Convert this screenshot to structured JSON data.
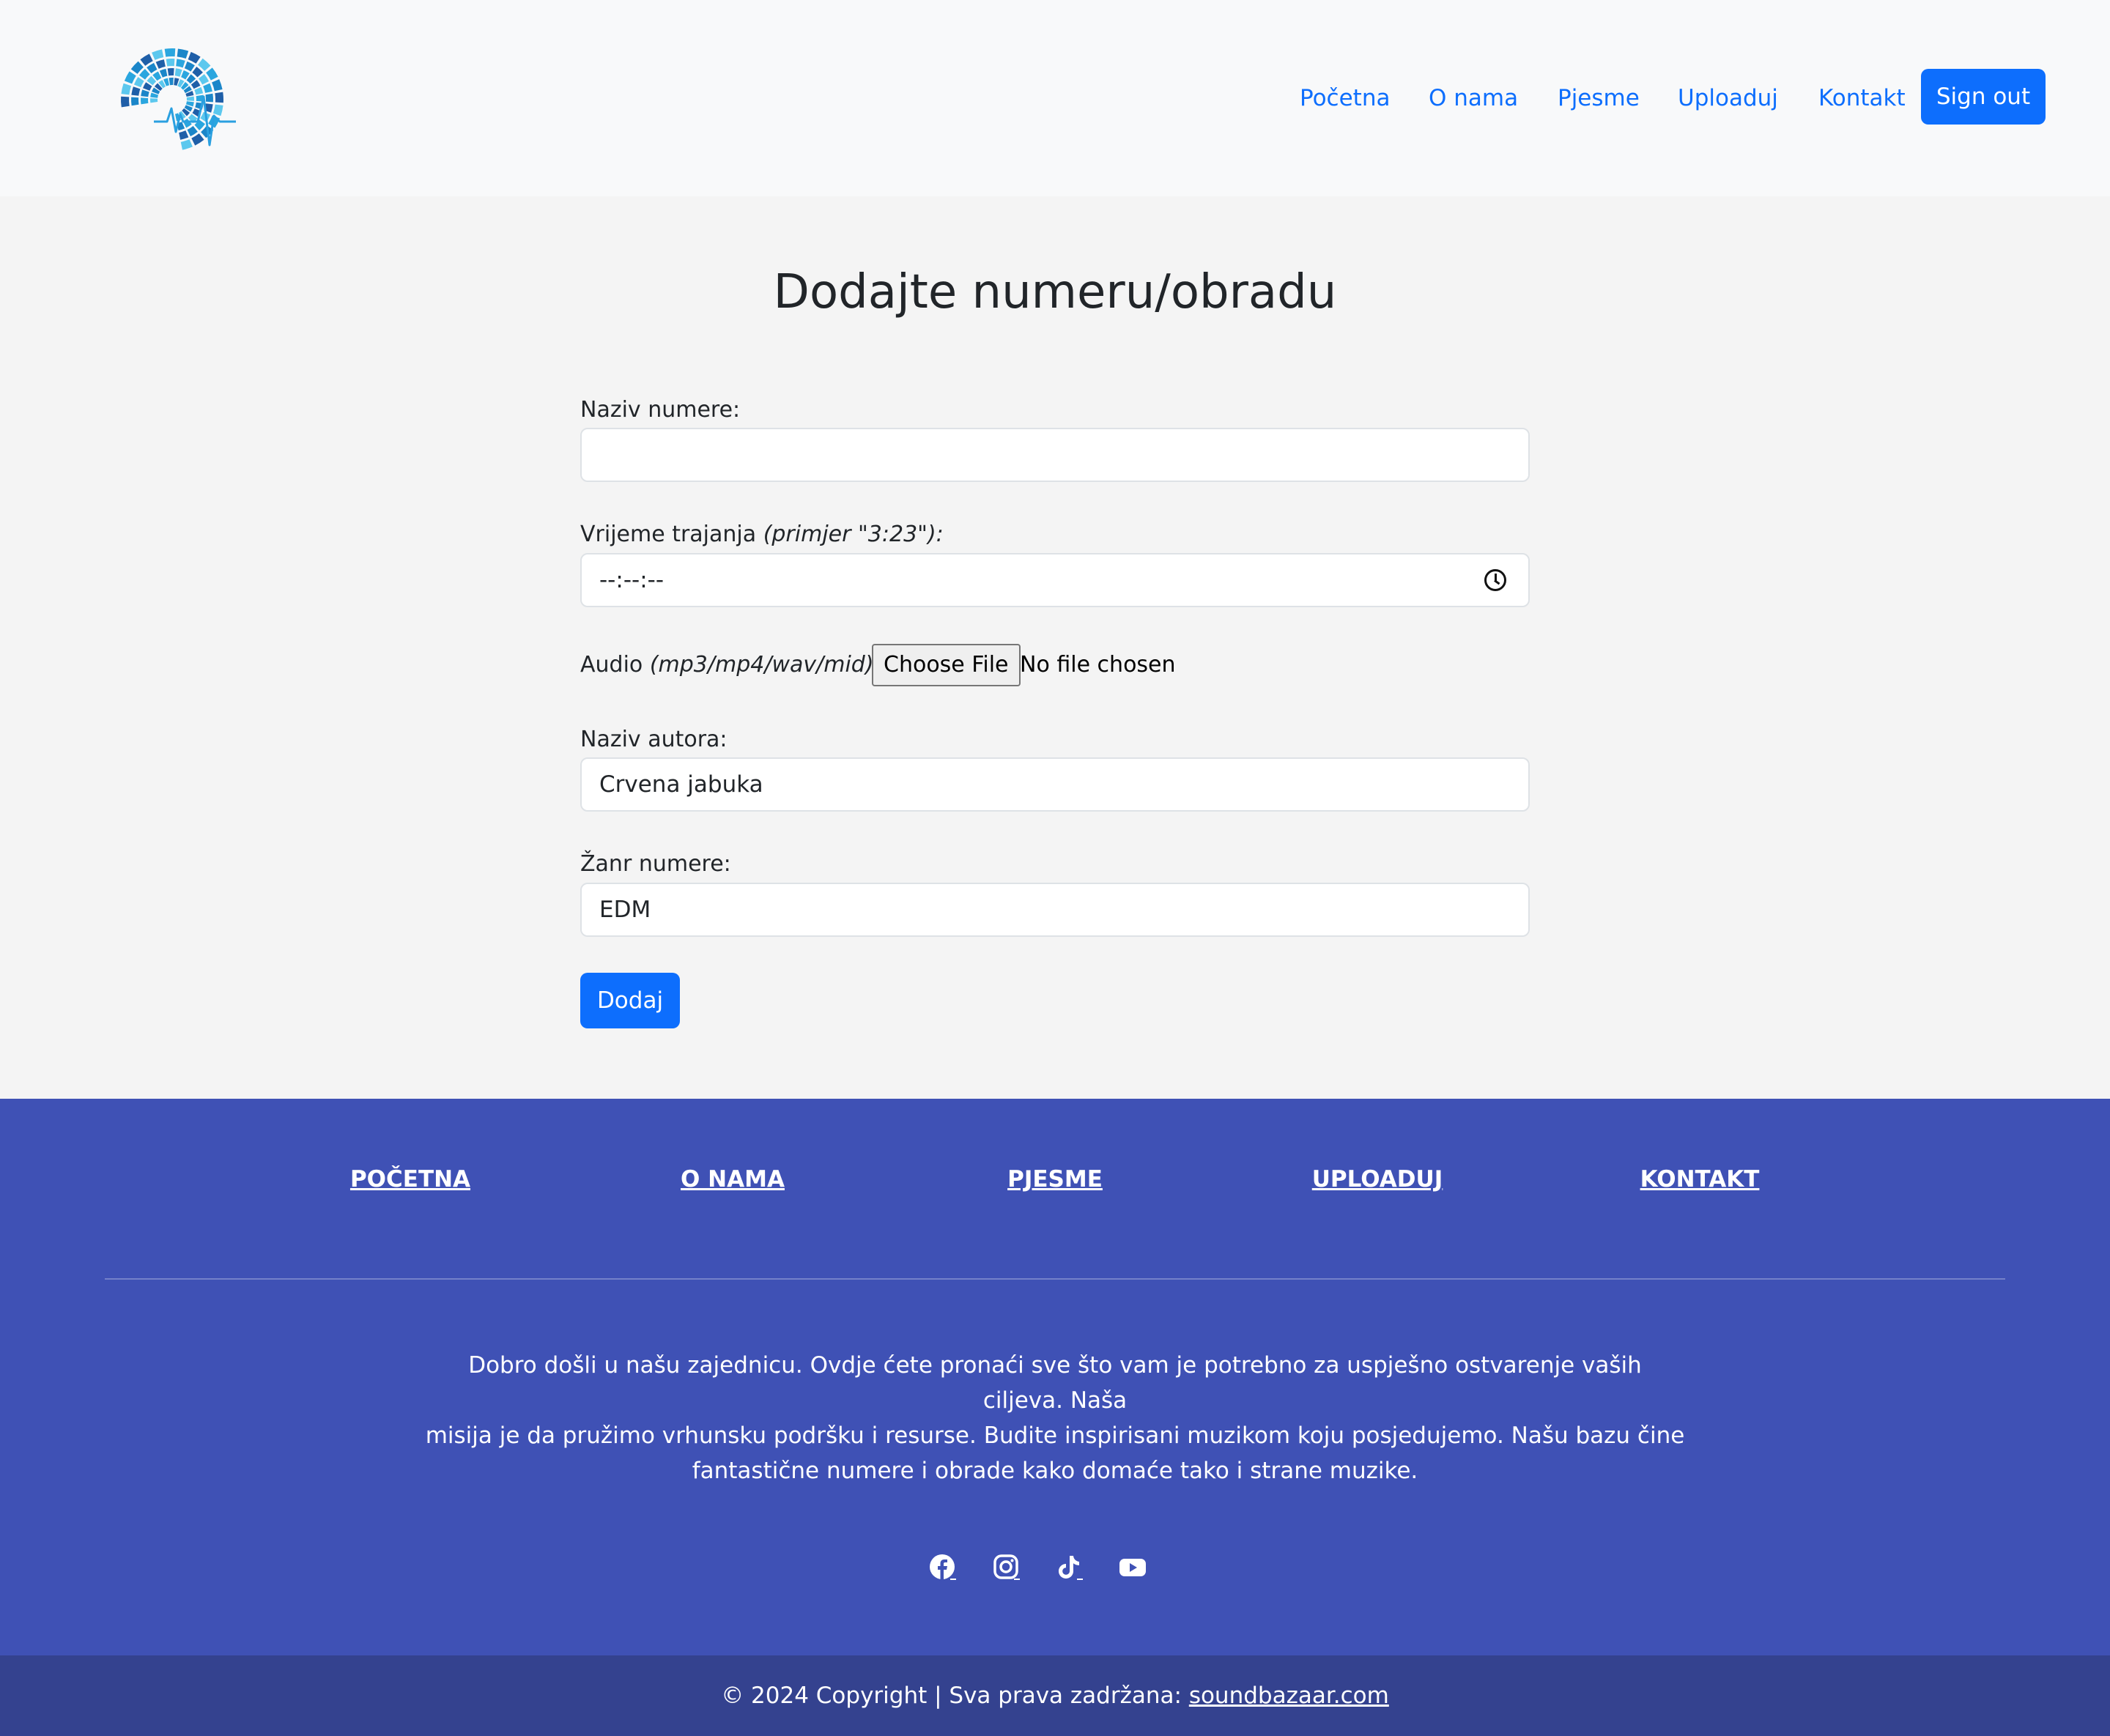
{
  "nav": {
    "items": [
      "Početna",
      "O nama",
      "Pjesme",
      "Uploaduj",
      "Kontakt"
    ],
    "signout_label": "Sign out"
  },
  "form": {
    "title": "Dodajte numeru/obradu",
    "song_name": {
      "label": "Naziv numere:",
      "value": ""
    },
    "duration": {
      "label": "Vrijeme trajanja",
      "hint": "(primjer \"3:23\"):",
      "value": "--:--:--"
    },
    "audio": {
      "label": "Audio",
      "hint": "(mp3/mp4/wav/mid):",
      "button": "Choose File",
      "status": "No file chosen"
    },
    "author": {
      "label": "Naziv autora:",
      "value": "Crvena jabuka"
    },
    "genre": {
      "label": "Žanr numere:",
      "value": "EDM"
    },
    "submit_label": "Dodaj"
  },
  "footer": {
    "links": [
      "POČETNA",
      "O NAMA",
      "PJESME",
      "UPLOADUJ",
      "KONTAKT"
    ],
    "text_lines": [
      "Dobro došli u našu zajednicu. Ovdje ćete pronaći sve što vam je potrebno za uspješno ostvarenje vaših ciljeva. Naša",
      "misija je da pružimo vrhunsku podršku i resurse. Budite inspirisani muzikom koju posjedujemo. Našu bazu čine",
      "fantastične numere i obrade kako domaće tako i strane muzike."
    ],
    "social_icons": [
      "facebook-icon",
      "instagram-icon",
      "tiktok-icon",
      "youtube-icon"
    ],
    "copyright_text": "© 2024 Copyright | Sva prava zadržana: ",
    "copyright_link": "soundbazaar.com"
  },
  "colors": {
    "accent": "#0d6efd",
    "footer": "#3f51b5",
    "footer_bottom": "#34428f"
  }
}
